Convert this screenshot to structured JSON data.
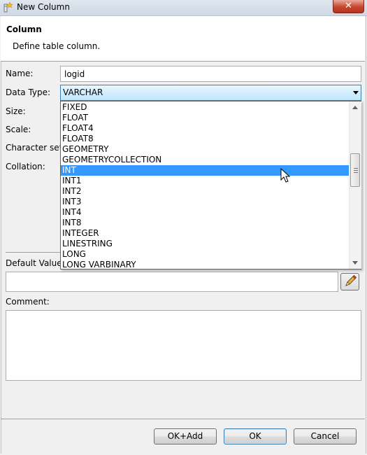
{
  "window": {
    "title": "New Column",
    "close_glyph": "✕"
  },
  "header": {
    "title": "Column",
    "description": "Define table column."
  },
  "form": {
    "name_label": "Name:",
    "name_value": "logid",
    "data_type_label": "Data Type:",
    "data_type_value": "VARCHAR",
    "size_label": "Size:",
    "scale_label": "Scale:",
    "charset_label": "Character set:",
    "collation_label": "Collation:",
    "default_label": "Default Value:",
    "comment_label": "Comment:"
  },
  "dropdown": {
    "items": [
      "FIXED",
      "FLOAT",
      "FLOAT4",
      "FLOAT8",
      "GEOMETRY",
      "GEOMETRYCOLLECTION",
      "INT",
      "INT1",
      "INT2",
      "INT3",
      "INT4",
      "INT8",
      "INTEGER",
      "LINESTRING",
      "LONG",
      "LONG VARBINARY"
    ],
    "selected_index": 6,
    "highlight_color": "#3399ff"
  },
  "buttons": {
    "ok_add": "OK+Add",
    "ok": "OK",
    "cancel": "Cancel"
  },
  "icons": {
    "title": "new-column-icon",
    "edit": "pencil-icon",
    "cursor": "mouse-pointer-icon"
  }
}
